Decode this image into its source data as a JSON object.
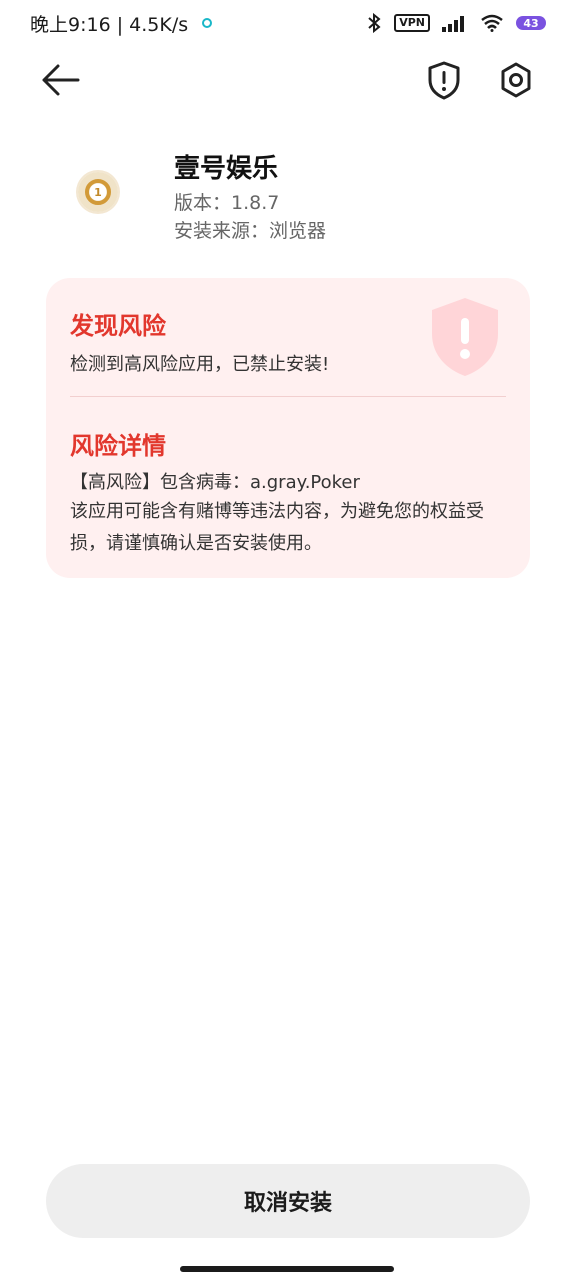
{
  "status_bar": {
    "time": "晚上9:16 | 4.5K/s",
    "vpn": "VPN",
    "battery": "43"
  },
  "nav": {
    "back_icon": "arrow-left-icon",
    "shield_icon": "shield-alert-icon",
    "settings_icon": "hexagon-settings-icon"
  },
  "app": {
    "name": "壹号娱乐",
    "version": "版本：1.8.7",
    "source": "安装来源：浏览器",
    "icon": "app-logo"
  },
  "risk": {
    "title": "发现风险",
    "description": "检测到高风险应用，已禁止安装!",
    "details_title": "风险详情",
    "virus_line": "【高风险】包含病毒：a.gray.Poker",
    "details_text": "该应用可能含有赌博等违法内容，为避免您的权益受损，请谨慎确认是否安装使用。",
    "accent_color": "#e2372d",
    "card_bg": "#fff0f0"
  },
  "actions": {
    "cancel_label": "取消安装"
  }
}
